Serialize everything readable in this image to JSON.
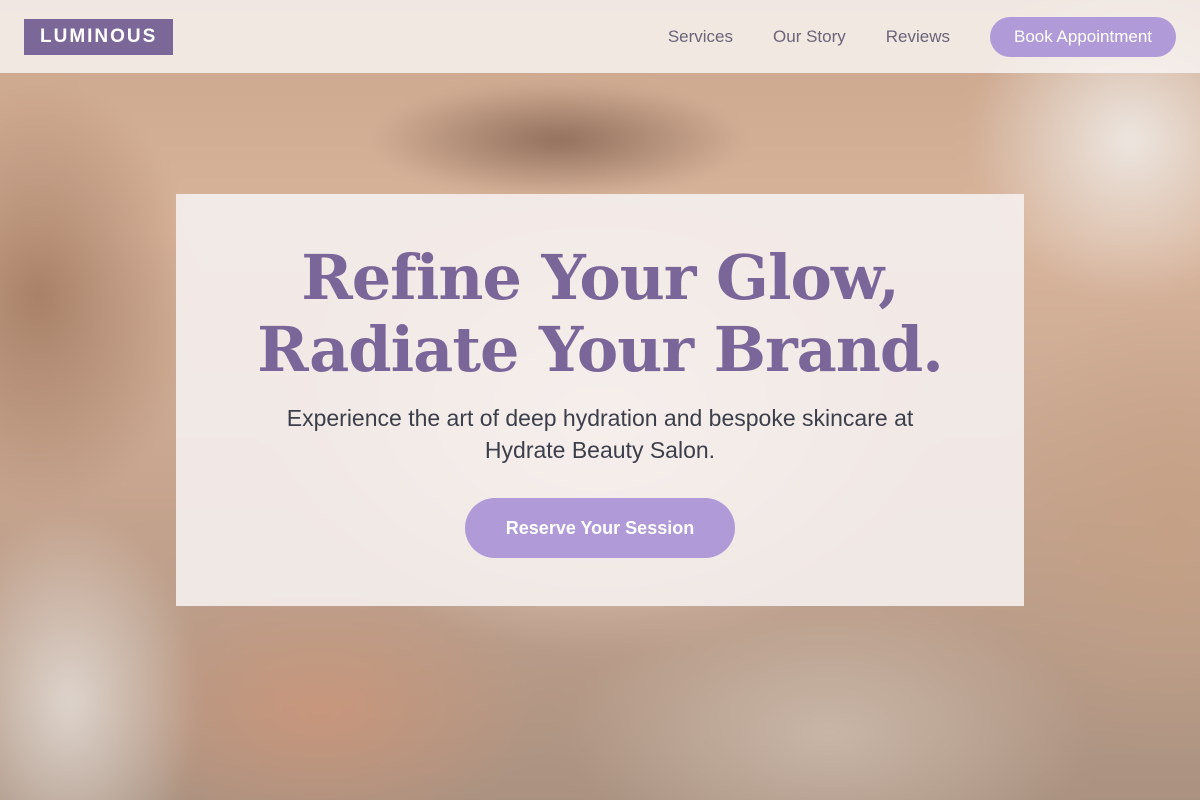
{
  "brand": {
    "logo_text": "LUMINOUS"
  },
  "nav": {
    "links": [
      "Services",
      "Our Story",
      "Reviews"
    ],
    "cta_label": "Book Appointment"
  },
  "hero": {
    "title_lines": [
      "Refine Your Glow,",
      "Radiate Your Brand."
    ],
    "subtitle_lines": [
      "Experience the art of deep hydration and bespoke skincare at",
      "Hydrate Beauty Salon."
    ],
    "cta_label": "Reserve Your Session"
  },
  "colors": {
    "accent": "#b09ad8",
    "brand_purple": "#7c6799",
    "title_purple": "#7b6699",
    "text_dark": "#3c3f4a",
    "nav_text": "#6b6478"
  }
}
